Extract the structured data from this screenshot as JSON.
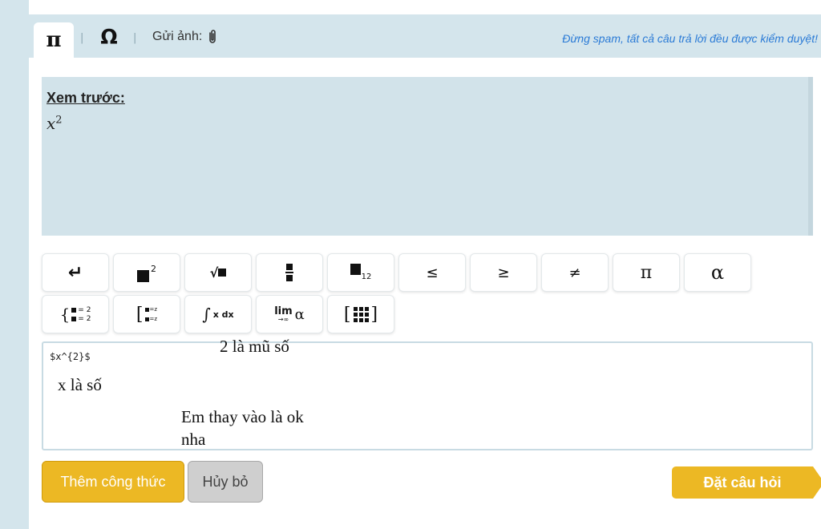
{
  "tabs": {
    "math": "π",
    "symbols": "Ω",
    "separator": "|",
    "upload_label": "Gửi ảnh:",
    "upload_icon": "paperclip-icon"
  },
  "notice": "Đừng spam, tất cả câu trả lời đều được kiểm duyệt!",
  "preview": {
    "title": "Xem trước:",
    "math_base": "x",
    "math_exp": "2"
  },
  "keyboard": {
    "row1": [
      {
        "name": "enter",
        "icon": "enter-icon",
        "label": "↵"
      },
      {
        "name": "power",
        "icon": "superscript-icon",
        "label": "2"
      },
      {
        "name": "sqrt",
        "icon": "sqrt-icon",
        "label": "√"
      },
      {
        "name": "fraction",
        "icon": "fraction-icon",
        "label": ""
      },
      {
        "name": "subscript",
        "icon": "subscript-icon",
        "label": "12"
      },
      {
        "name": "leq",
        "label": "≤"
      },
      {
        "name": "geq",
        "label": "≥"
      },
      {
        "name": "neq",
        "label": "≠"
      },
      {
        "name": "pi",
        "label": "π"
      },
      {
        "name": "alpha",
        "label": "α"
      }
    ],
    "row2": [
      {
        "name": "system",
        "icon": "equation-system-icon",
        "label": "= 2"
      },
      {
        "name": "interval",
        "icon": "bracket-icon",
        "label": "=z"
      },
      {
        "name": "integral",
        "icon": "integral-icon",
        "label": "x dx"
      },
      {
        "name": "limit",
        "icon": "limit-icon",
        "label": "lim",
        "sub": "→∞",
        "greek": "α"
      },
      {
        "name": "matrix",
        "icon": "matrix-icon",
        "label": ""
      }
    ]
  },
  "input": {
    "value": "$x^{2}$"
  },
  "notes": {
    "exponent": "2 là mũ số",
    "base": "x là số",
    "line1": "Em thay vào là ok",
    "line2": "nha"
  },
  "buttons": {
    "add_formula": "Thêm công thức",
    "cancel": "Hủy bỏ",
    "ask": "Đặt câu hỏi"
  },
  "colors": {
    "panel": "#d4e5ec",
    "accent": "#ecb824",
    "notice": "#2b7bd6"
  }
}
